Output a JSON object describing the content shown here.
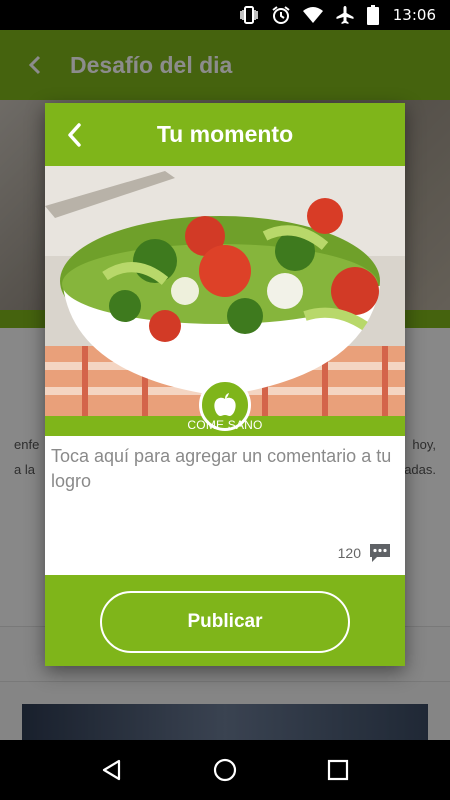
{
  "status_bar": {
    "time": "13:06",
    "icons": [
      "vibrate-icon",
      "alarm-icon",
      "wifi-icon",
      "airplane-mode-icon",
      "battery-icon"
    ]
  },
  "background": {
    "title": "Desafío del dia",
    "text_left_1": "enfe",
    "text_left_2": "a la",
    "text_right_1": "hoy,",
    "text_right_2": "adas."
  },
  "dialog": {
    "title": "Tu momento",
    "badge_label": "COME SANO",
    "badge_icon": "apple-icon",
    "comment_placeholder": "Toca aquí para agregar un comentario a tu logro",
    "char_counter": "120",
    "publish_label": "Publicar"
  },
  "colors": {
    "accent_green": "#7fb51a"
  },
  "nav_bar": {
    "icons": [
      "back-icon",
      "home-icon",
      "recents-icon"
    ]
  }
}
